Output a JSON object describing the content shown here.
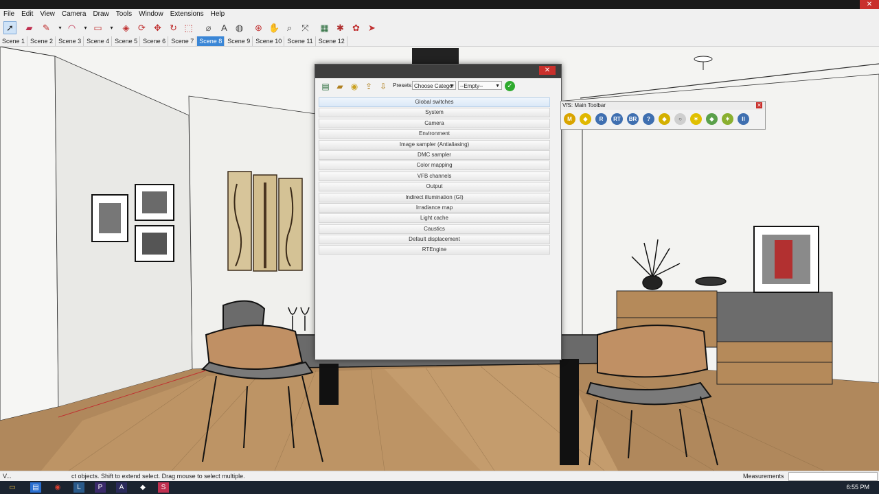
{
  "app": {
    "title_close": "✕"
  },
  "menu": [
    "File",
    "Edit",
    "View",
    "Camera",
    "Draw",
    "Tools",
    "Window",
    "Extensions",
    "Help"
  ],
  "toolbar_icons": [
    "select-icon",
    "eraser-icon",
    "pencil-icon",
    "arc-icon",
    "rectangle-icon",
    "push-pull-icon",
    "follow-me-icon",
    "move-icon",
    "rotate-icon",
    "scale-icon",
    "tape-measure-icon",
    "text-icon",
    "paint-bucket-icon",
    "orbit-icon",
    "pan-icon",
    "zoom-icon",
    "zoom-extents-icon",
    "warehouse-icon",
    "extension-icon",
    "layout-icon",
    "send-icon"
  ],
  "scenes": [
    "Scene 1",
    "Scene 2",
    "Scene 3",
    "Scene 4",
    "Scene 5",
    "Scene 6",
    "Scene 7",
    "Scene 8",
    "Scene 9",
    "Scene 10",
    "Scene 11",
    "Scene 12"
  ],
  "active_scene": "Scene 8",
  "dialog": {
    "close": "✕",
    "presets_label": "Presets:",
    "category_value": "Choose Categor",
    "preset_value": "--Empty--",
    "rollouts": [
      "Global switches",
      "System",
      "Camera",
      "Environment",
      "Image sampler (Antialiasing)",
      "DMC sampler",
      "Color mapping",
      "VFB channels",
      "Output",
      "Indirect illumination (GI)",
      "Irradiance map",
      "Light cache",
      "Caustics",
      "Default displacement",
      "RTEngine"
    ]
  },
  "vfs_toolbar": {
    "title": "VfS: Main Toolbar",
    "close": "✕",
    "buttons": [
      "M",
      "◆",
      "R",
      "RT",
      "BR",
      "?",
      "◆",
      "○",
      "✶",
      "◆",
      "✶",
      "II"
    ]
  },
  "status": {
    "left_icons": "V...",
    "message": "ct objects. Shift to extend select. Drag mouse to select multiple.",
    "measurements_label": "Measurements"
  },
  "taskbar": {
    "time": "6:55 PM"
  },
  "colors": {
    "accent": "#3a86d6",
    "close": "#c9302c",
    "floor": "#b0885c",
    "wall": "#ebebe8"
  }
}
